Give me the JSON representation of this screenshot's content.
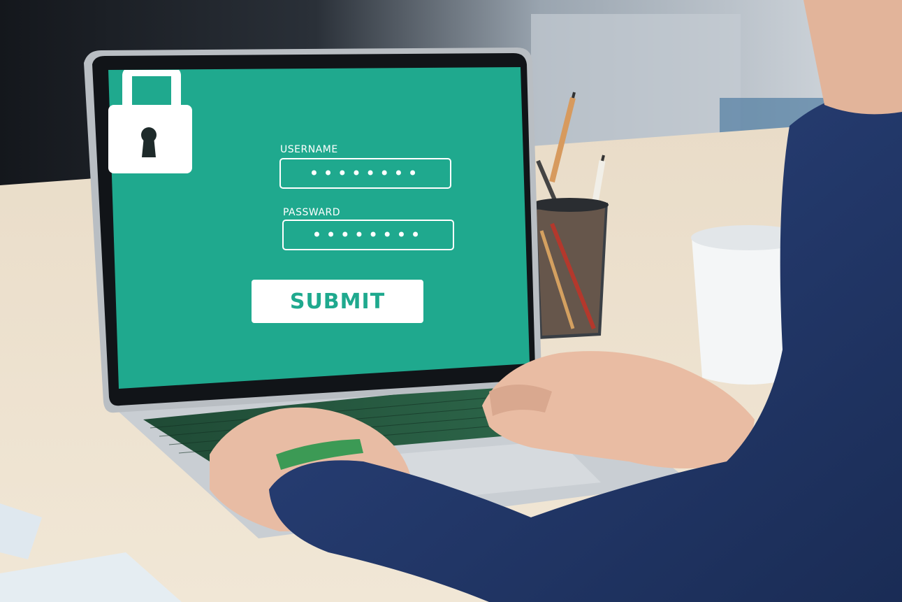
{
  "login_form": {
    "username_label": "USERNAME",
    "username_value": "••••••••",
    "password_label": "PASSWARD",
    "password_value": "••••••••",
    "submit_label": "SUBMIT"
  },
  "icons": {
    "lock": "padlock-icon"
  },
  "colors": {
    "screen_green": "#1fa98e",
    "desk": "#e8dcc8",
    "jacket": "#233a6b",
    "skin": "#e6b8a0"
  }
}
